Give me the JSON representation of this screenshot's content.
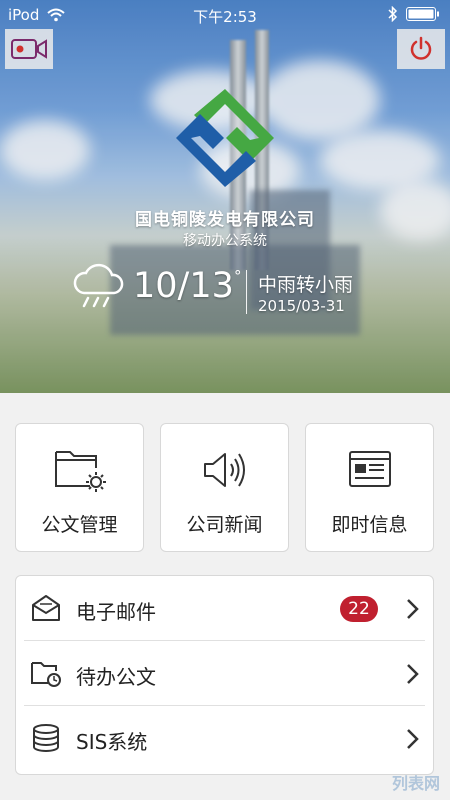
{
  "status_bar": {
    "carrier": "iPod",
    "time": "下午2:53"
  },
  "header": {
    "company_name": "国电铜陵发电有限公司",
    "subtitle": "移动办公系统"
  },
  "weather": {
    "temperature": "10/13",
    "degree_symbol": "°",
    "description": "中雨转小雨",
    "date": "2015/03-31",
    "icon": "cloud-rain-icon"
  },
  "tiles": [
    {
      "label": "公文管理",
      "icon": "folder-gear-icon"
    },
    {
      "label": "公司新闻",
      "icon": "speaker-icon"
    },
    {
      "label": "即时信息",
      "icon": "message-window-icon"
    }
  ],
  "menu": [
    {
      "label": "电子邮件",
      "icon": "mail-icon",
      "badge": "22"
    },
    {
      "label": "待办公文",
      "icon": "folder-clock-icon"
    },
    {
      "label": "SIS系统",
      "icon": "database-icon"
    }
  ],
  "watermark": "列表网",
  "colors": {
    "badge": "#c0202f",
    "logo_green": "#45a843",
    "logo_blue": "#1f5ea8",
    "power_red": "#d0312d"
  }
}
